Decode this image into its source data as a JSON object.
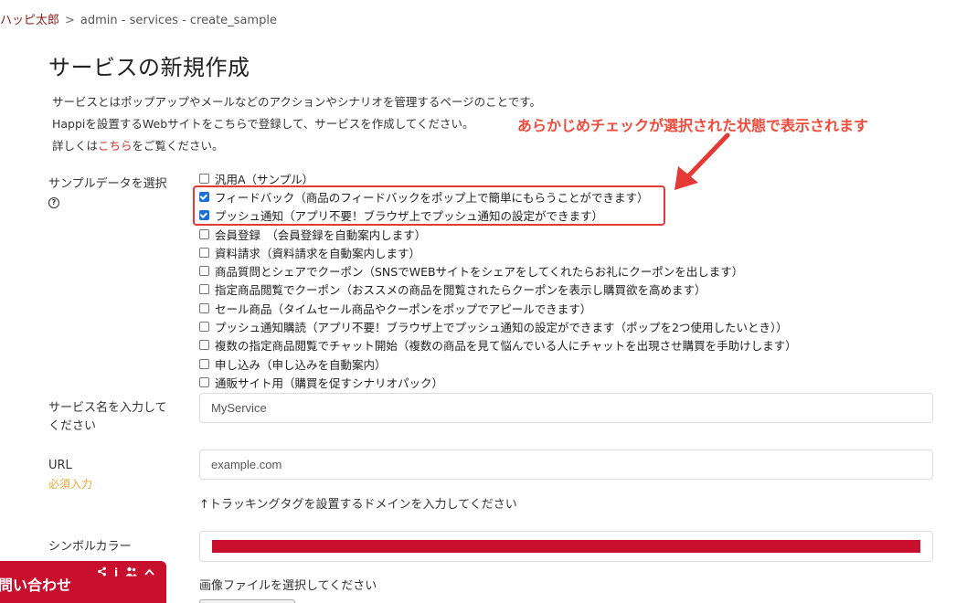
{
  "breadcrumb": {
    "home": "ハッピ太郎",
    "separator": ">",
    "path": "admin - services - create_sample"
  },
  "page_title": "サービスの新規作成",
  "description": {
    "line1": "サービスとはポップアップやメールなどのアクションやシナリオを管理するページのことです。",
    "line2": "Happiを設置するWebサイトをこちらで登録して、サービスを作成してください。",
    "line3_prefix": "詳しくは",
    "line3_link": "こちら",
    "line3_suffix": "をご覧ください。"
  },
  "annotation": {
    "text": "あらかじめチェックが選択された状態で表示されます",
    "color": "#f24a3c"
  },
  "sample_data": {
    "label": "サンプルデータを選択",
    "help_icon": "question-circle-icon",
    "items": [
      {
        "label": "汎用A（サンプル）",
        "checked": false
      },
      {
        "label": "フィードバック（商品のフィードバックをポップ上で簡単にもらうことができます）",
        "checked": true
      },
      {
        "label": "プッシュ通知（アプリ不要！ブラウザ上でプッシュ通知の設定ができます）",
        "checked": true
      },
      {
        "label": "会員登録　（会員登録を自動案内します）",
        "checked": false
      },
      {
        "label": "資料請求（資料請求を自動案内します）",
        "checked": false
      },
      {
        "label": "商品質問とシェアでクーポン（SNSでWEBサイトをシェアをしてくれたらお礼にクーポンを出します）",
        "checked": false
      },
      {
        "label": "指定商品閲覧でクーポン（おススメの商品を閲覧されたらクーポンを表示し購買欲を高めます）",
        "checked": false
      },
      {
        "label": "セール商品（タイムセール商品やクーポンをポップでアピールできます）",
        "checked": false
      },
      {
        "label": "プッシュ通知購読（アプリ不要！ブラウザ上でプッシュ通知の設定ができます（ポップを2つ使用したいとき））",
        "checked": false
      },
      {
        "label": "複数の指定商品閲覧でチャット開始（複数の商品を見て悩んでいる人にチャットを出現させ購買を手助けします）",
        "checked": false
      },
      {
        "label": "申し込み（申し込みを自動案内）",
        "checked": false
      },
      {
        "label": "通販サイト用（購買を促すシナリオパック）",
        "checked": false
      }
    ]
  },
  "service_name": {
    "label_line1": "サービス名を入力して",
    "label_line2": "ください",
    "placeholder": "MyService"
  },
  "url": {
    "label": "URL",
    "required": "必須入力",
    "placeholder": "example.com",
    "hint": "↑トラッキングタグを設置するドメインを入力してください"
  },
  "symbol_color": {
    "label": "シンボルカラー",
    "value": "#c8102e"
  },
  "image_file": {
    "label": "画像ファイルを選択してください"
  },
  "contact_widget": {
    "label": "問い合わせ",
    "icons": [
      "share-icon",
      "info-icon",
      "users-icon",
      "chevron-up-icon"
    ],
    "color": "#c8102e"
  }
}
